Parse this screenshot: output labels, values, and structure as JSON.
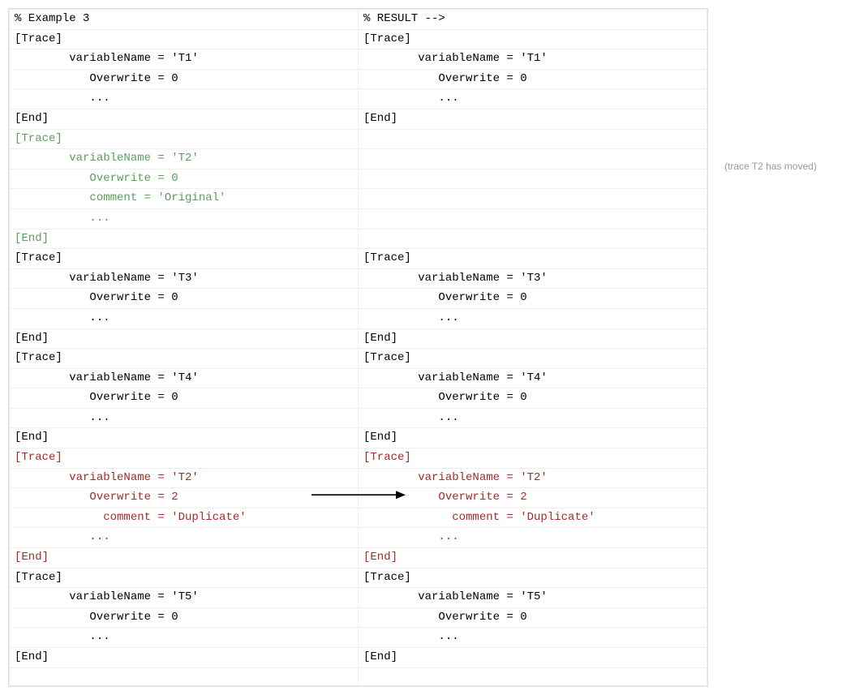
{
  "side_note": "(trace T2 has moved)",
  "rows": [
    {
      "l": "% Example 3",
      "r": "% RESULT -->"
    },
    {
      "l": "[Trace]",
      "r": "[Trace]"
    },
    {
      "l": "        variableName = 'T1'",
      "r": "        variableName = 'T1'"
    },
    {
      "l": "           Overwrite = 0",
      "r": "           Overwrite = 0"
    },
    {
      "l": "           ...",
      "r": "           ..."
    },
    {
      "l": "[End]",
      "r": "[End]"
    },
    {
      "l": "[Trace]",
      "r": "",
      "lclass": "green"
    },
    {
      "l": "        variableName = 'T2'",
      "r": "",
      "lclass": "green"
    },
    {
      "l": "           Overwrite = 0",
      "r": "",
      "lclass": "green"
    },
    {
      "l": "           comment = 'Original'",
      "r": "",
      "lclass": "green"
    },
    {
      "l": "           ...",
      "r": "",
      "lclass": "green"
    },
    {
      "l": "[End]",
      "r": "",
      "lclass": "green"
    },
    {
      "l": "[Trace]",
      "r": "[Trace]"
    },
    {
      "l": "        variableName = 'T3'",
      "r": "        variableName = 'T3'"
    },
    {
      "l": "           Overwrite = 0",
      "r": "           Overwrite = 0"
    },
    {
      "l": "           ...",
      "r": "           ..."
    },
    {
      "l": "[End]",
      "r": "[End]"
    },
    {
      "l": "[Trace]",
      "r": "[Trace]"
    },
    {
      "l": "        variableName = 'T4'",
      "r": "        variableName = 'T4'"
    },
    {
      "l": "           Overwrite = 0",
      "r": "           Overwrite = 0"
    },
    {
      "l": "           ...",
      "r": "           ..."
    },
    {
      "l": "[End]",
      "r": "[End]"
    },
    {
      "l": "[Trace]",
      "r": "[Trace]",
      "lclass": "darkred",
      "rclass": "darkred"
    },
    {
      "l": "        variableName = 'T2'",
      "r": "        variableName = 'T2'",
      "lclass": "darkred",
      "rclass": "darkred"
    },
    {
      "l": "           Overwrite = 2",
      "r": "           Overwrite = 2",
      "lclass": "darkred",
      "rclass": "darkred",
      "arrow": true
    },
    {
      "l": "             comment = 'Duplicate'",
      "r": "             comment = 'Duplicate'",
      "lclass": "darkred",
      "rclass": "darkred"
    },
    {
      "l": "           ...",
      "r": "           ...",
      "lclass": "darkred",
      "rclass": "darkred"
    },
    {
      "l": "[End]",
      "r": "[End]",
      "lclass": "darkred",
      "rclass": "darkred"
    },
    {
      "l": "[Trace]",
      "r": "[Trace]"
    },
    {
      "l": "        variableName = 'T5'",
      "r": "        variableName = 'T5'"
    },
    {
      "l": "           Overwrite = 0",
      "r": "           Overwrite = 0"
    },
    {
      "l": "           ...",
      "r": "           ..."
    },
    {
      "l": "[End]",
      "r": "[End]"
    },
    {
      "l": "",
      "r": ""
    }
  ]
}
